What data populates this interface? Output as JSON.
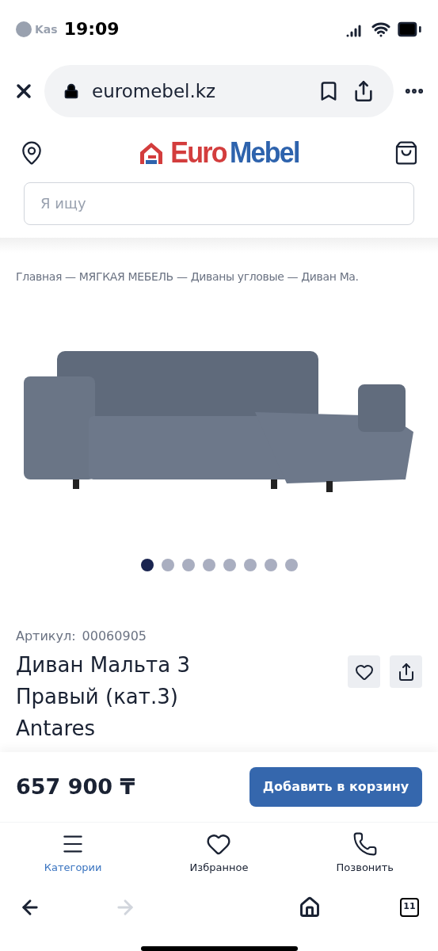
{
  "status_bar": {
    "back_app": "Kas",
    "time": "19:09"
  },
  "browser": {
    "url": "euromebel.kz",
    "tab_count": "11",
    "forward_disabled": true
  },
  "header": {
    "logo_part_1": "Euro",
    "logo_part_2": "Mebel",
    "search": {
      "placeholder": "Я ищу"
    }
  },
  "breadcrumb": "Главная — МЯГКАЯ МЕБЕЛЬ — Диваны угловые — Диван Ма.",
  "gallery": {
    "dots": [
      {
        "selected": true
      },
      {
        "selected": false
      },
      {
        "selected": false
      },
      {
        "selected": false
      },
      {
        "selected": false
      },
      {
        "selected": false
      },
      {
        "selected": false
      },
      {
        "selected": false
      }
    ]
  },
  "product": {
    "article_label": "Артикул:",
    "article": "00060905",
    "title": "Диван Мальта 3 Правый (кат.3) Antares",
    "price": "657 900 ₸",
    "add_to_cart": "Добавить в корзину"
  },
  "bottom_nav": [
    {
      "kind": "menu",
      "label": "Категории",
      "selected": true
    },
    {
      "kind": "heart",
      "label": "Избранное",
      "selected": false
    },
    {
      "kind": "phone",
      "label": "Позвонить",
      "selected": false
    }
  ]
}
